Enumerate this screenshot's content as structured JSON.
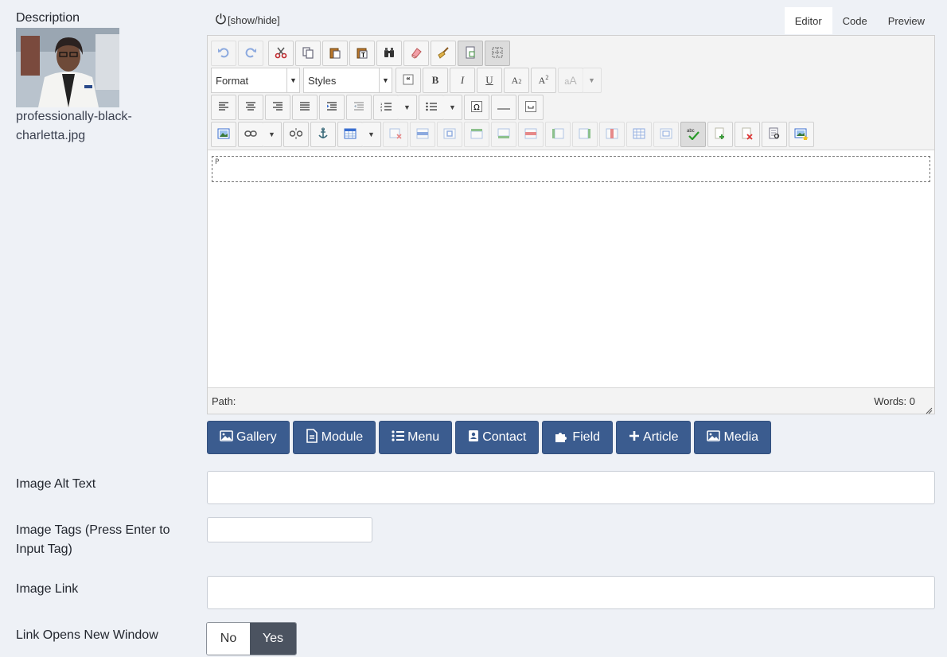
{
  "description_label": "Description",
  "image": {
    "filename": "professionally-black-charletta.jpg"
  },
  "editor": {
    "toggle_label": "[show/hide]",
    "tabs": {
      "editor": "Editor",
      "code": "Code",
      "preview": "Preview",
      "active": "Editor"
    },
    "format_select": "Format",
    "styles_select": "Styles",
    "path_label": "Path:",
    "words_label": "Words: 0",
    "block_tag": "P"
  },
  "insert_buttons": {
    "gallery": "Gallery",
    "module": "Module",
    "menu": "Menu",
    "contact": "Contact",
    "field": "Field",
    "article": "Article",
    "media": "Media"
  },
  "fields": {
    "alt_text_label": "Image Alt Text",
    "alt_text_value": "",
    "tags_label": "Image Tags (Press Enter to Input Tag)",
    "tags_value": "",
    "link_label": "Image Link",
    "link_value": "",
    "new_window_label": "Link Opens New Window",
    "new_window_options": {
      "no": "No",
      "yes": "Yes"
    },
    "new_window_selected": "Yes"
  },
  "colors": {
    "accent": "#3b5c8f",
    "page_bg": "#eef1f6",
    "toggle_on": "#4b5360"
  }
}
